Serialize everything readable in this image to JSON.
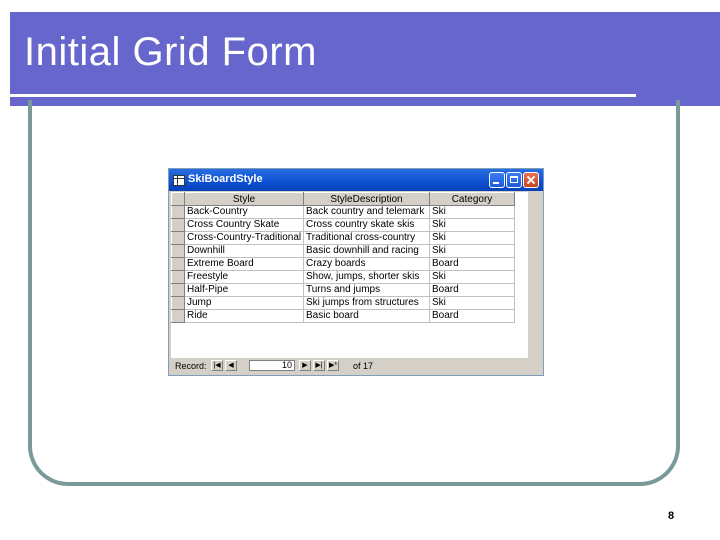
{
  "slide": {
    "title": "Initial Grid Form",
    "page_number": "8"
  },
  "window": {
    "title": "SkiBoardStyle",
    "columns": [
      "Style",
      "StyleDescription",
      "Category"
    ],
    "rows": [
      [
        "Back-Country",
        "Back country and telemark",
        "Ski"
      ],
      [
        "Cross Country Skate",
        "Cross country skate skis",
        "Ski"
      ],
      [
        "Cross-Country-Traditional",
        "Traditional cross-country",
        "Ski"
      ],
      [
        "Downhill",
        "Basic downhill and racing",
        "Ski"
      ],
      [
        "Extreme Board",
        "Crazy boards",
        "Board"
      ],
      [
        "Freestyle",
        "Show, jumps, shorter skis",
        "Ski"
      ],
      [
        "Half-Pipe",
        "Turns and jumps",
        "Board"
      ],
      [
        "Jump",
        "Ski jumps from structures",
        "Ski"
      ],
      [
        "Ride",
        "Basic board",
        "Board"
      ]
    ],
    "nav": {
      "label": "Record:",
      "first": "|◀",
      "prev": "◀",
      "current": "10",
      "next": "▶",
      "last": "▶|",
      "new": "▶*",
      "total": "of 17"
    }
  }
}
